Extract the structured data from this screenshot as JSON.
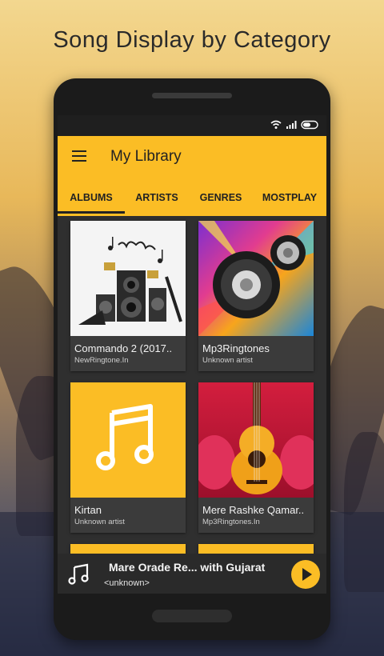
{
  "headline": "Song Display by Category",
  "app": {
    "title": "My Library",
    "tabs": [
      {
        "label": "ALBUMS",
        "active": true
      },
      {
        "label": "ARTISTS",
        "active": false
      },
      {
        "label": "GENRES",
        "active": false
      },
      {
        "label": "MOSTPLAY",
        "active": false
      }
    ],
    "albums": [
      {
        "title": "Commando 2 (2017..",
        "artist": "NewRingtone.In",
        "art": "speakers-music-notes"
      },
      {
        "title": "Mp3Ringtones",
        "artist": "Unknown artist",
        "art": "colorful-speaker"
      },
      {
        "title": "Kirtan",
        "artist": "Unknown artist",
        "art": "music-note-icon"
      },
      {
        "title": "Mere Rashke Qamar..",
        "artist": "Mp3Ringtones.In",
        "art": "guitars"
      }
    ],
    "player": {
      "title": "Mare Orade Re... with Gujarat",
      "subtitle": "<unknown>"
    }
  },
  "colors": {
    "accent": "#fbbd25",
    "screen_bg": "#2f2f2f",
    "card_bg": "#3b3b3b"
  }
}
